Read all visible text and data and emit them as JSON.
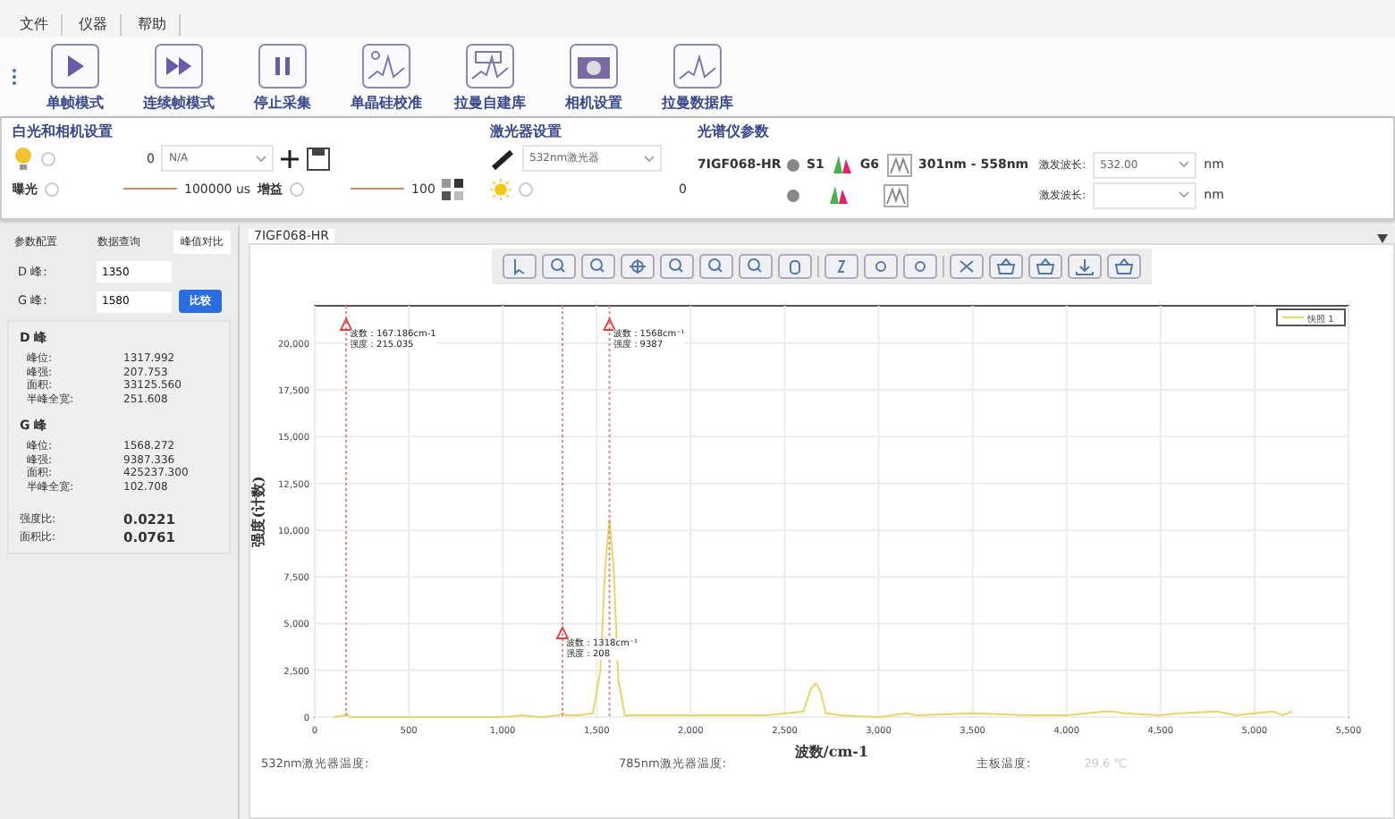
{
  "menu": [
    "文件",
    "仪器",
    "帮助"
  ],
  "toolbar": [
    {
      "label": "单帧模式",
      "kind": "play"
    },
    {
      "label": "连续帧模式",
      "kind": "fast"
    },
    {
      "label": "停止采集",
      "kind": "pause"
    },
    {
      "label": "单晶硅校准",
      "kind": "calib"
    },
    {
      "label": "拉曼自建库",
      "kind": "library"
    },
    {
      "label": "相机设置",
      "kind": "camera"
    },
    {
      "label": "拉曼数据库",
      "kind": "database"
    }
  ],
  "white_light": {
    "title": "白光和相机设置",
    "light": {
      "level": 0,
      "reading": "0"
    },
    "select": "N/A",
    "exposure_label": "曝光",
    "exposure": {
      "level": 0,
      "reading": "100000 us"
    },
    "gain_label": "增益",
    "gain": {
      "level": 0,
      "reading": "100"
    }
  },
  "laser": {
    "title": "激光器设置",
    "select": "532nm激光器",
    "power": {
      "level": 0,
      "reading": "0"
    }
  },
  "spectrometer": {
    "title": "光谱仪参数",
    "model": "7IGF068-HR",
    "slit": "S1",
    "grating": "G6",
    "range": "301nm - 558nm",
    "rows": [
      {
        "label": "激发波长:",
        "value": "532.00",
        "unit": "nm"
      },
      {
        "label": "激发波长:",
        "value": "",
        "unit": "nm"
      }
    ]
  },
  "left_panel": {
    "tabs": [
      {
        "label": "参数配置",
        "selected": false
      },
      {
        "label": "数据查询",
        "selected": false
      },
      {
        "label": "峰值对比",
        "selected": true
      }
    ],
    "fields": [
      {
        "label": "D 峰:",
        "value": "1350"
      },
      {
        "label": "G 峰:",
        "value": "1580"
      }
    ],
    "button": "比较",
    "groups": [
      {
        "title": "D 峰",
        "rows": [
          [
            "峰位:",
            "1317.992"
          ],
          [
            "峰强:",
            "207.753"
          ],
          [
            "面积:",
            "33125.560"
          ],
          [
            "半峰全宽:",
            "251.608"
          ]
        ]
      },
      {
        "title": "G 峰",
        "rows": [
          [
            "峰位:",
            "1568.272"
          ],
          [
            "峰强:",
            "9387.336"
          ],
          [
            "面积:",
            "425237.300"
          ],
          [
            "半峰全宽:",
            "102.708"
          ]
        ]
      }
    ],
    "ratios": [
      [
        "强度比:",
        "0.0221"
      ],
      [
        "面积比:",
        "0.0761"
      ]
    ]
  },
  "chart_tab": "7IGF068-HR",
  "chart_data": {
    "type": "line",
    "xlabel": "波数/cm-1",
    "ylabel": "强度(计数)",
    "xlim": [
      0,
      5500
    ],
    "ylim": [
      0,
      22000
    ],
    "xticks": [
      {
        "value": 0,
        "label": "0"
      },
      {
        "value": 500,
        "label": "500"
      },
      {
        "value": 1000,
        "label": "1,000"
      },
      {
        "value": 1500,
        "label": "1,500"
      },
      {
        "value": 2000,
        "label": "2,000"
      },
      {
        "value": 2500,
        "label": "2,500"
      },
      {
        "value": 3000,
        "label": "3,000"
      },
      {
        "value": 3500,
        "label": "3,500"
      },
      {
        "value": 4000,
        "label": "4,000"
      },
      {
        "value": 4500,
        "label": "4,500"
      },
      {
        "value": 5000,
        "label": "5,000"
      },
      {
        "value": 5500,
        "label": "5,500"
      }
    ],
    "yticks": [
      {
        "value": 0,
        "label": "0"
      },
      {
        "value": 2500,
        "label": "2,500"
      },
      {
        "value": 5000,
        "label": "5,000"
      },
      {
        "value": 7500,
        "label": "7,500"
      },
      {
        "value": 10000,
        "label": "10,000"
      },
      {
        "value": 12500,
        "label": "12,500"
      },
      {
        "value": 15000,
        "label": "15,000"
      },
      {
        "value": 17500,
        "label": "17,500"
      },
      {
        "value": 20000,
        "label": "20,000"
      }
    ],
    "x": [
      100,
      160,
      170,
      190,
      300,
      500,
      800,
      1000,
      1100,
      1200,
      1300,
      1318,
      1340,
      1400,
      1480,
      1520,
      1545,
      1568,
      1590,
      1615,
      1650,
      1750,
      2000,
      2400,
      2600,
      2640,
      2665,
      2690,
      2720,
      2800,
      3000,
      3150,
      3200,
      3500,
      3800,
      4000,
      4200,
      4250,
      4300,
      4500,
      4600,
      4800,
      4850,
      4900,
      5000,
      5100,
      5150,
      5200
    ],
    "series": [
      {
        "name": "快照 1",
        "color": "#e8d66a",
        "values": [
          0,
          100,
          200,
          0,
          0,
          0,
          0,
          0,
          100,
          0,
          100,
          200,
          100,
          100,
          200,
          2500,
          8000,
          10600,
          8000,
          2000,
          100,
          100,
          100,
          100,
          300,
          1500,
          1800,
          1400,
          200,
          100,
          0,
          200,
          100,
          200,
          100,
          100,
          300,
          300,
          200,
          100,
          200,
          300,
          200,
          100,
          200,
          300,
          100,
          300
        ]
      }
    ],
    "grid": true,
    "ref_lines": [
      {
        "axis": "x",
        "value": 167
      },
      {
        "axis": "x",
        "value": 1318
      },
      {
        "axis": "x",
        "value": 1568
      }
    ],
    "annotations": [
      {
        "x": 167,
        "y": 21000,
        "text": "波数：167.186cm-1\n强度：215.035"
      },
      {
        "x": 1568,
        "y": 21000,
        "text": "波数：1568cm⁻¹\n强度：9387"
      },
      {
        "x": 1318,
        "y": 4500,
        "text": "波数：1318cm⁻¹\n强度：208"
      }
    ]
  },
  "status": [
    {
      "label": "532nm激光器温度:"
    },
    {
      "label": "785nm激光器温度:"
    },
    {
      "label": "主板温度:",
      "value": "29.6 ℃"
    }
  ]
}
